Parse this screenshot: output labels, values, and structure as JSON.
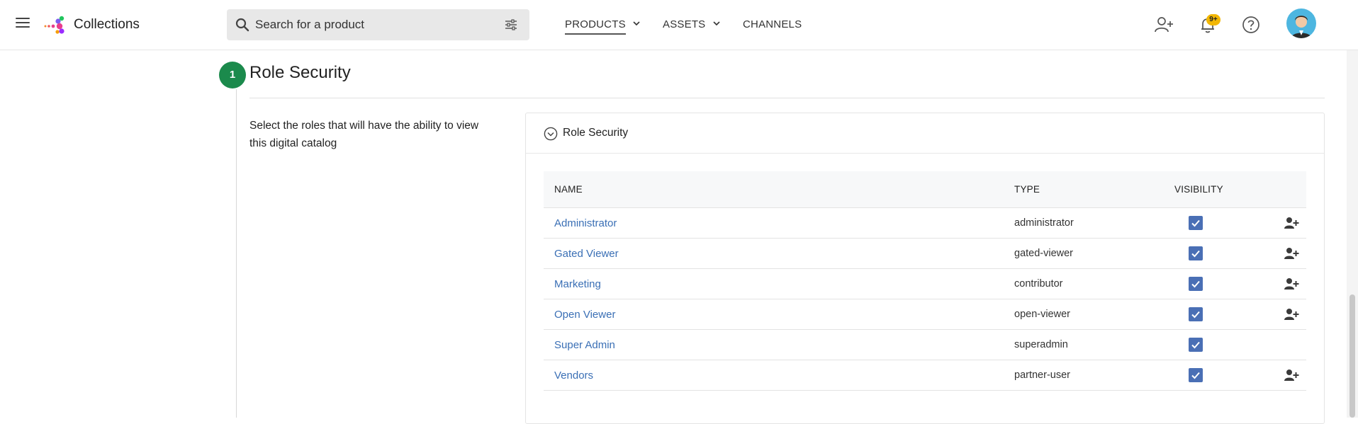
{
  "header": {
    "app_title": "Collections",
    "search_placeholder": "Search for a product",
    "nav": [
      {
        "label": "PRODUCTS"
      },
      {
        "label": "ASSETS"
      },
      {
        "label": "CHANNELS"
      }
    ],
    "notification_badge": "9+"
  },
  "step": {
    "number": "1",
    "title": "Role Security",
    "description": "Select the roles that will have the ability to view this digital catalog"
  },
  "panel": {
    "title": "Role Security",
    "columns": {
      "name": "NAME",
      "type": "TYPE",
      "visibility": "VISIBILITY"
    },
    "rows": [
      {
        "name": "Administrator",
        "type": "administrator",
        "visible": true,
        "has_user_action": true
      },
      {
        "name": "Gated Viewer",
        "type": "gated-viewer",
        "visible": true,
        "has_user_action": true
      },
      {
        "name": "Marketing",
        "type": "contributor",
        "visible": true,
        "has_user_action": true
      },
      {
        "name": "Open Viewer",
        "type": "open-viewer",
        "visible": true,
        "has_user_action": true
      },
      {
        "name": "Super Admin",
        "type": "superadmin",
        "visible": true,
        "has_user_action": false
      },
      {
        "name": "Vendors",
        "type": "partner-user",
        "visible": true,
        "has_user_action": true
      }
    ]
  },
  "colors": {
    "step_badge": "#1b8a4c",
    "link": "#3a6fb5",
    "checkbox": "#4a6fb5",
    "notification_badge": "#f2b705",
    "avatar_bg": "#4db6e0"
  }
}
